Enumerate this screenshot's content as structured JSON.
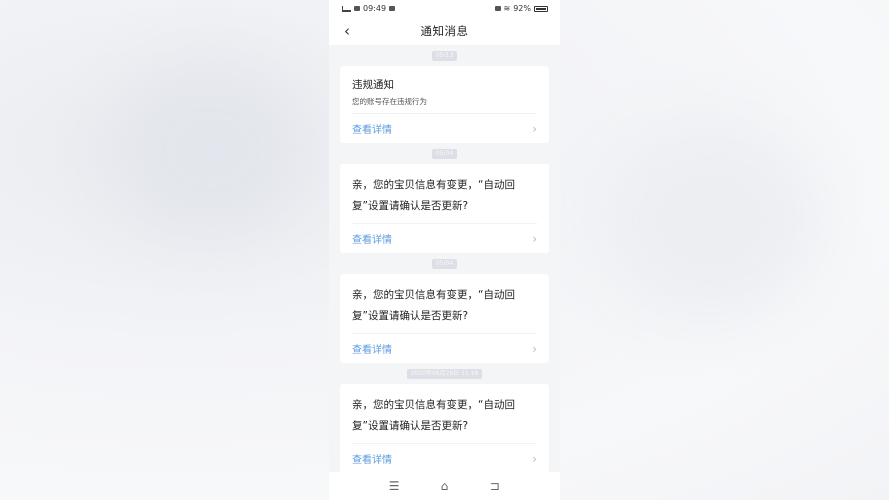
{
  "status_bar": {
    "time": "09:49",
    "battery": "92%"
  },
  "header": {
    "title": "通知消息",
    "back_icon": "chevron-left-icon"
  },
  "notifications": [
    {
      "timestamp": "05/13",
      "title": "违规通知",
      "subtitle": "您的账号存在违规行为",
      "link_label": "查看详情"
    },
    {
      "timestamp": "05/04",
      "body": "亲，您的宝贝信息有变更，“自动回复”设置请确认是否更新?",
      "link_label": "查看详情"
    },
    {
      "timestamp": "05/04",
      "body": "亲，您的宝贝信息有变更，“自动回复”设置请确认是否更新?",
      "link_label": "查看详情"
    },
    {
      "timestamp": "2020年06月28日 11:18",
      "body": "亲，您的宝贝信息有变更，“自动回复”设置请确认是否更新?",
      "link_label": "查看详情"
    }
  ],
  "bottom_nav": {
    "menu_icon": "menu-icon",
    "home_icon": "home-icon",
    "back_icon": "return-icon"
  }
}
